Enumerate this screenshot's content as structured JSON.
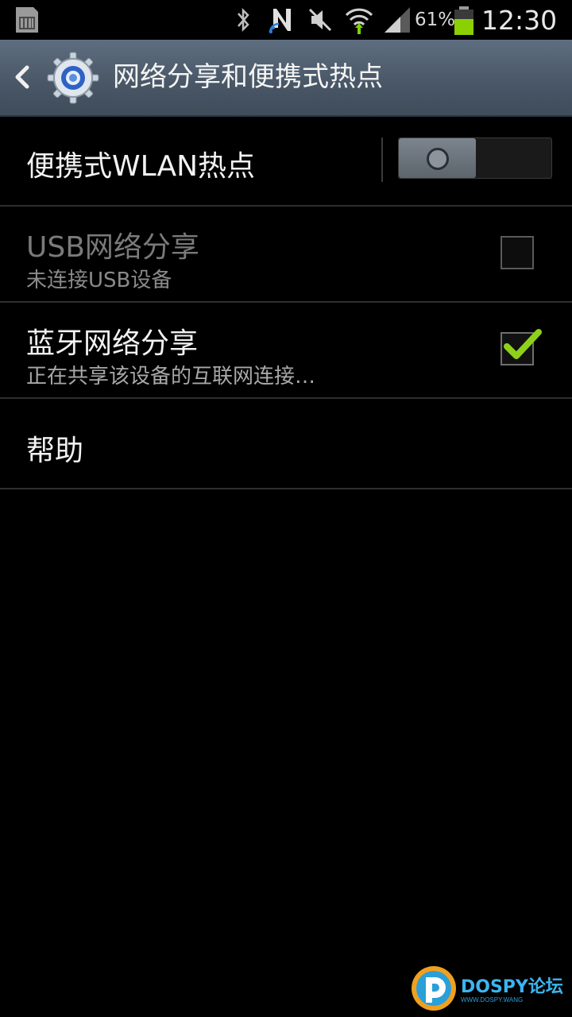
{
  "status_bar": {
    "battery_percent": "61%",
    "time": "12:30",
    "colors": {
      "battery": "#8bd000",
      "wifi_arrow": "#7bd000",
      "nfc_accent": "#2d7fd8"
    },
    "icons": [
      "sd-card-icon",
      "bluetooth-icon",
      "nfc-icon",
      "mute-icon",
      "wifi-icon",
      "signal-icon",
      "battery-icon"
    ]
  },
  "action_bar": {
    "title": "网络分享和便携式热点",
    "icons": [
      "back-icon",
      "settings-gear-icon"
    ]
  },
  "settings": {
    "hotspot": {
      "label": "便携式WLAN热点",
      "switch_on": false
    },
    "usb": {
      "label": "USB网络分享",
      "summary": "未连接USB设备",
      "checked": false,
      "enabled": false
    },
    "bluetooth": {
      "label": "蓝牙网络分享",
      "summary": "正在共享该设备的互联网连接…",
      "checked": true,
      "enabled": true
    },
    "help": {
      "label": "帮助"
    }
  },
  "watermark": {
    "brand": "DOSPY论坛",
    "sub": "WWW.DOSPY.WANG"
  }
}
